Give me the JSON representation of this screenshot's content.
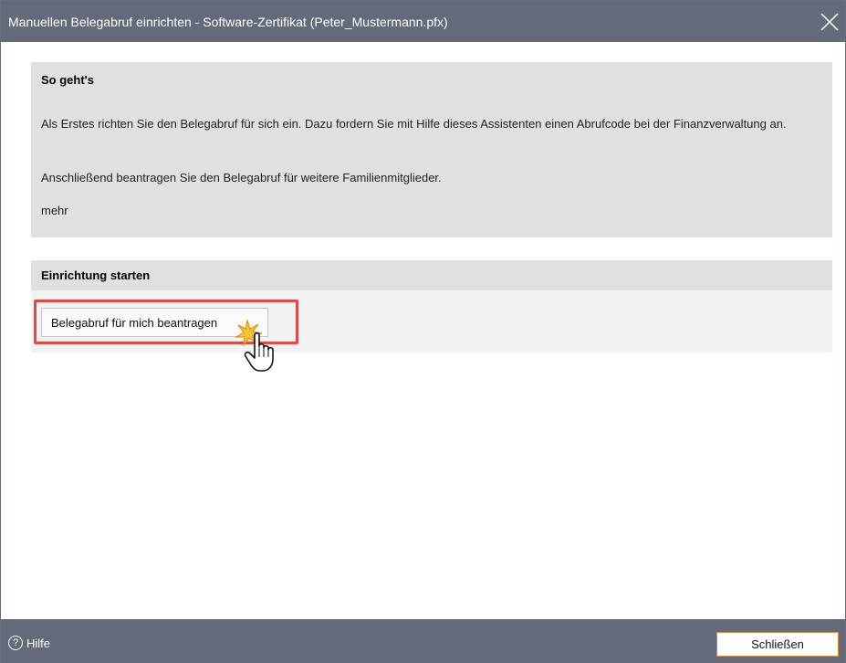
{
  "window": {
    "title": "Manuellen Belegabruf einrichten - Software-Zertifikat (Peter_Mustermann.pfx)"
  },
  "info_panel": {
    "heading": "So geht's",
    "paragraph1": "Als Erstes richten Sie den Belegabruf für sich ein. Dazu fordern Sie mit Hilfe dieses Assistenten einen Abrufcode bei der Finanzverwaltung an.",
    "paragraph2": "Anschließend beantragen Sie den Belegabruf für weitere Familienmitglieder.",
    "more_link": "mehr"
  },
  "setup_panel": {
    "heading": "Einrichtung starten",
    "request_button": "Belegabruf für mich beantragen"
  },
  "footer": {
    "help_icon": "?",
    "help_label": "Hilfe",
    "close_button": "Schließen"
  },
  "colors": {
    "titlebar": "#656a7b",
    "panel": "#e0e0e0",
    "highlight": "#e04a4a",
    "close_button_border": "#d58b3a"
  },
  "icons": {
    "close": "close-icon",
    "help": "help-circle-icon",
    "cursor": "hand-pointer-icon"
  }
}
